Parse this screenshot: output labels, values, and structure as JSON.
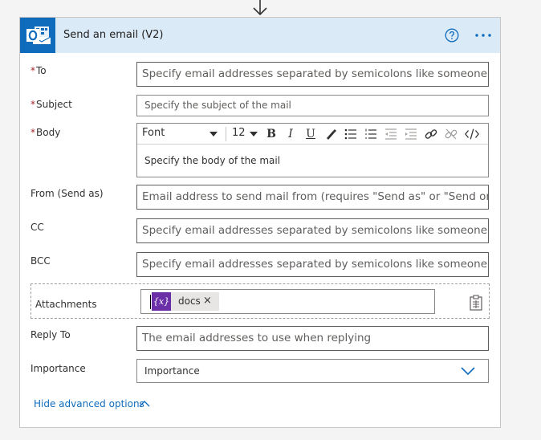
{
  "card": {
    "title": "Send an email (V2)",
    "app_icon": "outlook-icon",
    "accent_color": "#0f6cbd",
    "header_color": "#dbeaf7"
  },
  "fields": {
    "to": {
      "required_mark": "*",
      "label": "To",
      "placeholder": "Specify email addresses separated by semicolons like someone@contoso.com"
    },
    "subject": {
      "required_mark": "*",
      "label": "Subject",
      "placeholder": "Specify the subject of the mail"
    },
    "body": {
      "required_mark": "*",
      "label": "Body",
      "placeholder": "Specify the body of the mail",
      "toolbar": {
        "font": "Font",
        "font_size": "12",
        "bold": "B",
        "italic": "I",
        "underline": "U"
      }
    },
    "from": {
      "label": "From (Send as)",
      "placeholder": "Email address to send mail from (requires \"Send as\" or \"Send on behalf of\" permission)"
    },
    "cc": {
      "label": "CC",
      "placeholder": "Specify email addresses separated by semicolons like someone@contoso.com"
    },
    "bcc": {
      "label": "BCC",
      "placeholder": "Specify email addresses separated by semicolons like someone@contoso.com"
    },
    "attachments": {
      "label": "Attachments",
      "token": {
        "icon_text": "{x}",
        "label": "docs",
        "remove": "×"
      }
    },
    "reply_to": {
      "label": "Reply To",
      "placeholder": "The email addresses to use when replying"
    },
    "importance": {
      "label": "Importance",
      "placeholder": "Importance"
    }
  },
  "footer": {
    "toggle_label": "Hide advanced options"
  }
}
